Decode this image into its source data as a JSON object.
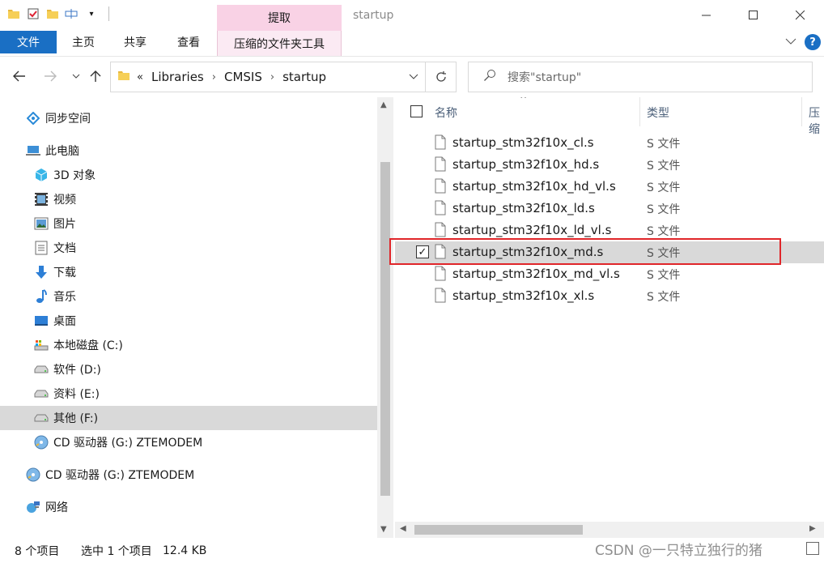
{
  "window": {
    "title": "startup",
    "context_tab_group": "提取"
  },
  "ribbon": {
    "tabs": [
      "文件",
      "主页",
      "共享",
      "查看",
      "压缩的文件夹工具"
    ]
  },
  "address": {
    "overflow": "«",
    "crumbs": [
      "Libraries",
      "CMSIS",
      "startup"
    ]
  },
  "search": {
    "placeholder": "搜索\"startup\""
  },
  "nav": {
    "items": [
      {
        "label": "同步空间",
        "icon": "sync-space-icon"
      },
      {
        "label": "此电脑",
        "icon": "this-pc-icon"
      },
      {
        "label": "3D 对象",
        "icon": "3d-objects-icon"
      },
      {
        "label": "视频",
        "icon": "video-icon"
      },
      {
        "label": "图片",
        "icon": "pictures-icon"
      },
      {
        "label": "文档",
        "icon": "documents-icon"
      },
      {
        "label": "下载",
        "icon": "download-icon"
      },
      {
        "label": "音乐",
        "icon": "music-icon"
      },
      {
        "label": "桌面",
        "icon": "desktop-icon"
      },
      {
        "label": "本地磁盘 (C:)",
        "icon": "local-disk-icon"
      },
      {
        "label": "软件 (D:)",
        "icon": "drive-icon"
      },
      {
        "label": "资料 (E:)",
        "icon": "drive-icon"
      },
      {
        "label": "其他 (F:)",
        "icon": "drive-icon"
      },
      {
        "label": "CD 驱动器 (G:) ZTEMODEM",
        "icon": "cd-drive-icon"
      },
      {
        "label": "CD 驱动器 (G:) ZTEMODEM",
        "icon": "cd-drive-icon"
      },
      {
        "label": "网络",
        "icon": "network-icon"
      }
    ]
  },
  "columns": {
    "name": "名称",
    "type": "类型",
    "compressed": "压缩"
  },
  "files": [
    {
      "name": "startup_stm32f10x_cl.s",
      "type": "S 文件",
      "selected": false
    },
    {
      "name": "startup_stm32f10x_hd.s",
      "type": "S 文件",
      "selected": false
    },
    {
      "name": "startup_stm32f10x_hd_vl.s",
      "type": "S 文件",
      "selected": false
    },
    {
      "name": "startup_stm32f10x_ld.s",
      "type": "S 文件",
      "selected": false
    },
    {
      "name": "startup_stm32f10x_ld_vl.s",
      "type": "S 文件",
      "selected": false
    },
    {
      "name": "startup_stm32f10x_md.s",
      "type": "S 文件",
      "selected": true
    },
    {
      "name": "startup_stm32f10x_md_vl.s",
      "type": "S 文件",
      "selected": false
    },
    {
      "name": "startup_stm32f10x_xl.s",
      "type": "S 文件",
      "selected": false
    }
  ],
  "status": {
    "count": "8 个项目",
    "selection": "选中 1 个项目",
    "size": "12.4 KB"
  },
  "watermark": "CSDN @一只特立独行的猪   ",
  "colors": {
    "file_tab": "#1a6fc4",
    "context_tab": "#f9d2e5",
    "highlight_box": "#e0262a",
    "selection": "#d9d9d9"
  }
}
